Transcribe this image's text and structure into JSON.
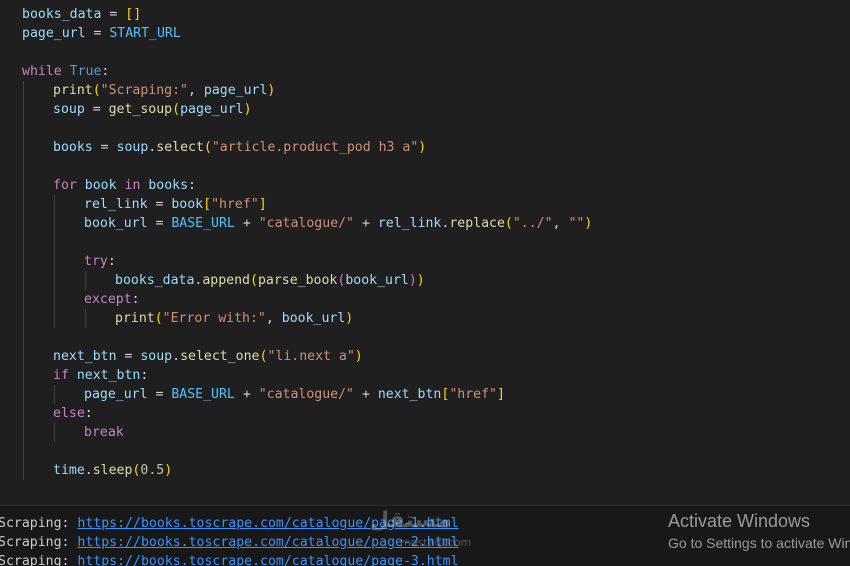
{
  "code": {
    "l1": {
      "a": "books_data",
      "b": " = ",
      "c": "[",
      "d": "]"
    },
    "l2": {
      "a": "page_url",
      "b": " = ",
      "c": "START_URL"
    },
    "l4": {
      "a": "while",
      "b": " ",
      "c": "True",
      "d": ":"
    },
    "l5": {
      "a": "print",
      "b": "(",
      "c": "\"Scraping:\"",
      "d": ", ",
      "e": "page_url",
      "f": ")"
    },
    "l6": {
      "a": "soup",
      "b": " = ",
      "c": "get_soup",
      "d": "(",
      "e": "page_url",
      "f": ")"
    },
    "l8": {
      "a": "books",
      "b": " = ",
      "c": "soup",
      "d": ".",
      "e": "select",
      "f": "(",
      "g": "\"article.product_pod h3 a\"",
      "h": ")"
    },
    "l10": {
      "a": "for",
      "b": " ",
      "c": "book",
      "d": " ",
      "e": "in",
      "f": " ",
      "g": "books",
      "h": ":"
    },
    "l11": {
      "a": "rel_link",
      "b": " = ",
      "c": "book",
      "d": "[",
      "e": "\"href\"",
      "f": "]"
    },
    "l12": {
      "a": "book_url",
      "b": " = ",
      "c": "BASE_URL",
      "d": " + ",
      "e": "\"catalogue/\"",
      "f": " + ",
      "g": "rel_link",
      "h": ".",
      "i": "replace",
      "j": "(",
      "k": "\"../\"",
      "l": ", ",
      "m": "\"\"",
      "n": ")"
    },
    "l14": {
      "a": "try",
      "b": ":"
    },
    "l15": {
      "a": "books_data",
      "b": ".",
      "c": "append",
      "d": "(",
      "e": "parse_book",
      "f": "(",
      "g": "book_url",
      "h": ")",
      "i": ")"
    },
    "l16": {
      "a": "except",
      "b": ":"
    },
    "l17": {
      "a": "print",
      "b": "(",
      "c": "\"Error with:\"",
      "d": ", ",
      "e": "book_url",
      "f": ")"
    },
    "l19": {
      "a": "next_btn",
      "b": " = ",
      "c": "soup",
      "d": ".",
      "e": "select_one",
      "f": "(",
      "g": "\"li.next a\"",
      "h": ")"
    },
    "l20": {
      "a": "if",
      "b": " ",
      "c": "next_btn",
      "d": ":"
    },
    "l21": {
      "a": "page_url",
      "b": " = ",
      "c": "BASE_URL",
      "d": " + ",
      "e": "\"catalogue/\"",
      "f": " + ",
      "g": "next_btn",
      "h": "[",
      "i": "\"href\"",
      "j": "]"
    },
    "l22": {
      "a": "else",
      "b": ":"
    },
    "l23": {
      "a": "break"
    },
    "l25": {
      "a": "time",
      "b": ".",
      "c": "sleep",
      "d": "(",
      "e": "0.5",
      "f": ")"
    }
  },
  "terminal": [
    {
      "label": "Scraping:",
      "url": "https://books.toscrape.com/catalogue/page-1.html"
    },
    {
      "label": "Scraping:",
      "url": "https://books.toscrape.com/catalogue/page-2.html"
    },
    {
      "label": "Scraping:",
      "url": "https://books.toscrape.com/catalogue/page-3.html"
    }
  ],
  "watermark": {
    "text": "مستقل",
    "sub": "mostaql.com"
  },
  "activation": {
    "title": "Activate Windows",
    "subtitle": "Go to Settings to activate Windows."
  },
  "colors": {
    "background": "#1f1f1f",
    "keyword": "#c586c0",
    "function": "#dcdcaa",
    "string": "#ce9178",
    "variable": "#9cdcfe",
    "link": "#3794ff"
  }
}
